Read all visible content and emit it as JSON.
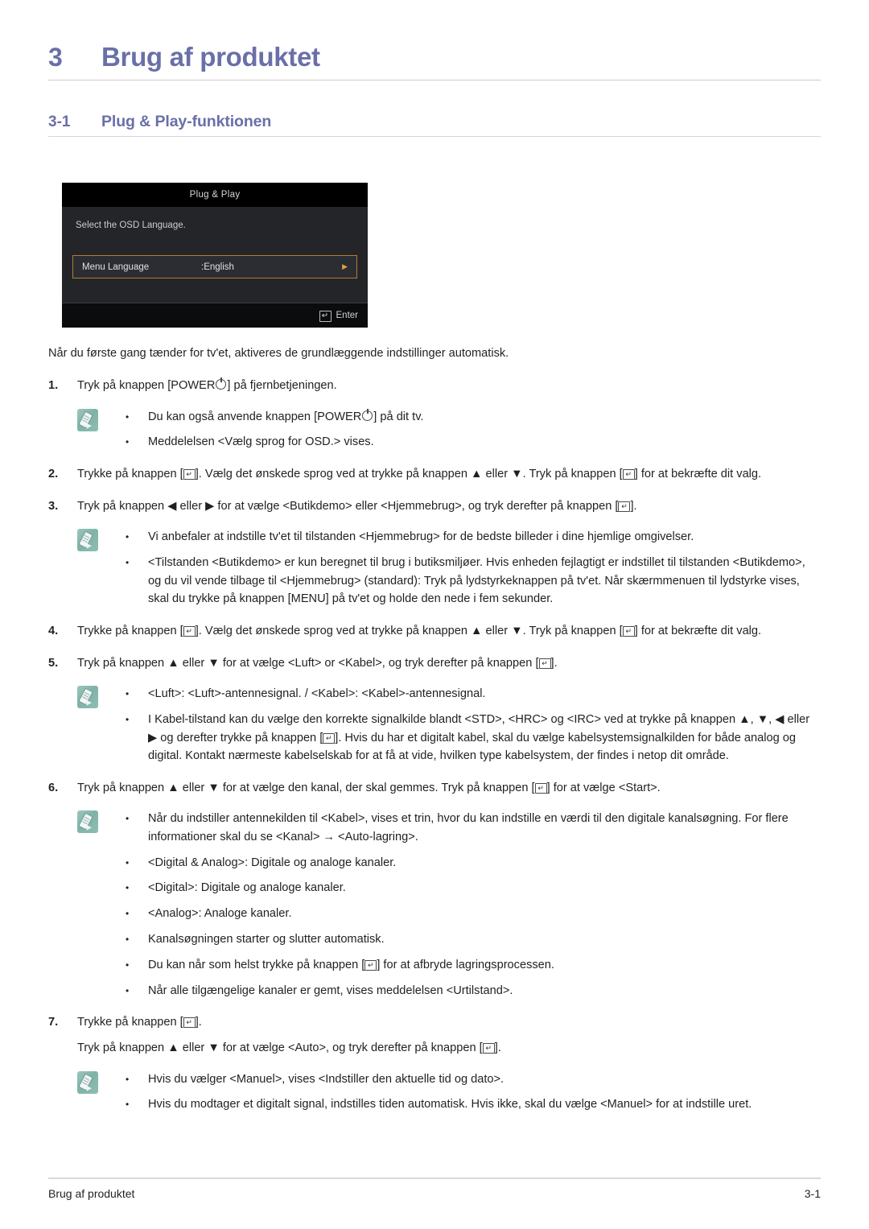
{
  "chapter": {
    "number": "3",
    "title": "Brug af produktet"
  },
  "section": {
    "number": "3-1",
    "title": "Plug & Play-funktionen"
  },
  "osd": {
    "title": "Plug & Play",
    "prompt": "Select the OSD Language.",
    "row_label": "Menu Language",
    "row_value": ":English",
    "row_arrow": "▶",
    "enter_glyph": "↵",
    "enter_label": "Enter"
  },
  "intro": "Når du første gang tænder for tv'et, aktiveres de grundlæggende indstillinger automatisk.",
  "steps": [
    {
      "num": "1.",
      "text_before": "Tryk på knappen [POWER",
      "text_after": "] på fjernbetjeningen."
    },
    {
      "num": "2.",
      "part1": "Trykke på knappen [",
      "part2": "]. Vælg det ønskede sprog ved at trykke på knappen ▲ eller ▼. Tryk på knappen [",
      "part3": "] for at bekræfte dit valg."
    },
    {
      "num": "3.",
      "part1": "Tryk på knappen ◀ eller ▶ for at vælge <Butikdemo> eller <Hjemmebrug>, og tryk derefter på knappen [",
      "part2": "]."
    },
    {
      "num": "4.",
      "part1": "Trykke på knappen [",
      "part2": "]. Vælg det ønskede sprog ved at trykke på knappen ▲ eller ▼. Tryk på knappen [",
      "part3": "] for at bekræfte dit valg."
    },
    {
      "num": "5.",
      "part1": "Tryk på knappen ▲ eller ▼ for at vælge <Luft> or <Kabel>, og tryk derefter på knappen [",
      "part2": "]."
    },
    {
      "num": "6.",
      "part1": "Tryk på knappen ▲ eller ▼ for at vælge den kanal, der skal gemmes. Tryk på knappen [",
      "part2": "] for at vælge <Start>."
    },
    {
      "num": "7.",
      "part1": "Trykke på knappen [",
      "part2": "].",
      "extra1": "Tryk på knappen ▲ eller ▼ for at vælge <Auto>, og tryk derefter på knappen [",
      "extra2": "]."
    }
  ],
  "notes": {
    "note1": {
      "bullet": "•",
      "item1_before": "Du kan også anvende knappen [POWER",
      "item1_after": "] på dit tv.",
      "item2": "Meddelelsen <Vælg sprog for OSD.> vises."
    },
    "note2": {
      "bullet": "•",
      "item1": "Vi anbefaler at indstille tv'et til tilstanden <Hjemmebrug> for de bedste billeder i dine hjemlige omgivelser.",
      "item2": "<Tilstanden <Butikdemo> er kun beregnet til brug i butiksmiljøer. Hvis enheden fejlagtigt er indstillet til tilstanden <Butikdemo>, og du vil vende tilbage til <Hjemmebrug> (standard): Tryk på lydstyrkeknappen på tv'et. Når skærmmenuen til lydstyrke vises, skal du trykke på knappen [MENU] på tv'et og holde den nede i fem sekunder."
    },
    "note3": {
      "bullet": "•",
      "item1": "<Luft>: <Luft>-antennesignal. / <Kabel>: <Kabel>-antennesignal.",
      "item2_part1": "I Kabel-tilstand kan du vælge den korrekte signalkilde blandt <STD>, <HRC> og <IRC> ved at trykke på knappen ▲, ▼, ◀ eller ▶ og derefter trykke på knappen [",
      "item2_part2": "]. Hvis du har et digitalt kabel, skal du vælge kabelsystemsignalkilden for både analog og digital. Kontakt nærmeste kabelselskab for at få at vide, hvilken type kabelsystem, der findes i netop dit område."
    },
    "note4": {
      "bullet": "•",
      "item1": "Når du indstiller antennekilden til <Kabel>, vises et trin, hvor du kan indstille en værdi til den digitale kanalsøgning. For flere informationer skal du se <Kanal> → <Auto-lagring>.",
      "item2": "<Digital & Analog>: Digitale og analoge kanaler.",
      "item3": "<Digital>: Digitale og analoge kanaler.",
      "item4": "<Analog>: Analoge kanaler.",
      "item5": "Kanalsøgningen starter og slutter automatisk.",
      "item6_part1": "Du kan når som helst trykke på knappen [",
      "item6_part2": "] for at afbryde lagringsprocessen.",
      "item7": "Når alle tilgængelige kanaler er gemt, vises meddelelsen <Urtilstand>."
    },
    "note5": {
      "bullet": "•",
      "item1": "Hvis du vælger <Manuel>, vises <Indstiller den aktuelle tid og dato>.",
      "item2": "Hvis du modtager et digitalt signal, indstilles tiden automatisk. Hvis ikke, skal du vælge <Manuel> for at indstille uret."
    }
  },
  "footer": {
    "left": "Brug af produktet",
    "right": "3-1"
  },
  "colors": {
    "heading": "#6a6fa8",
    "body_text": "#231f20",
    "osd_background": "#232529",
    "osd_highlight_border": "#b07f31",
    "note_icon": "#8fbdb3"
  },
  "key_glyph": "↵"
}
